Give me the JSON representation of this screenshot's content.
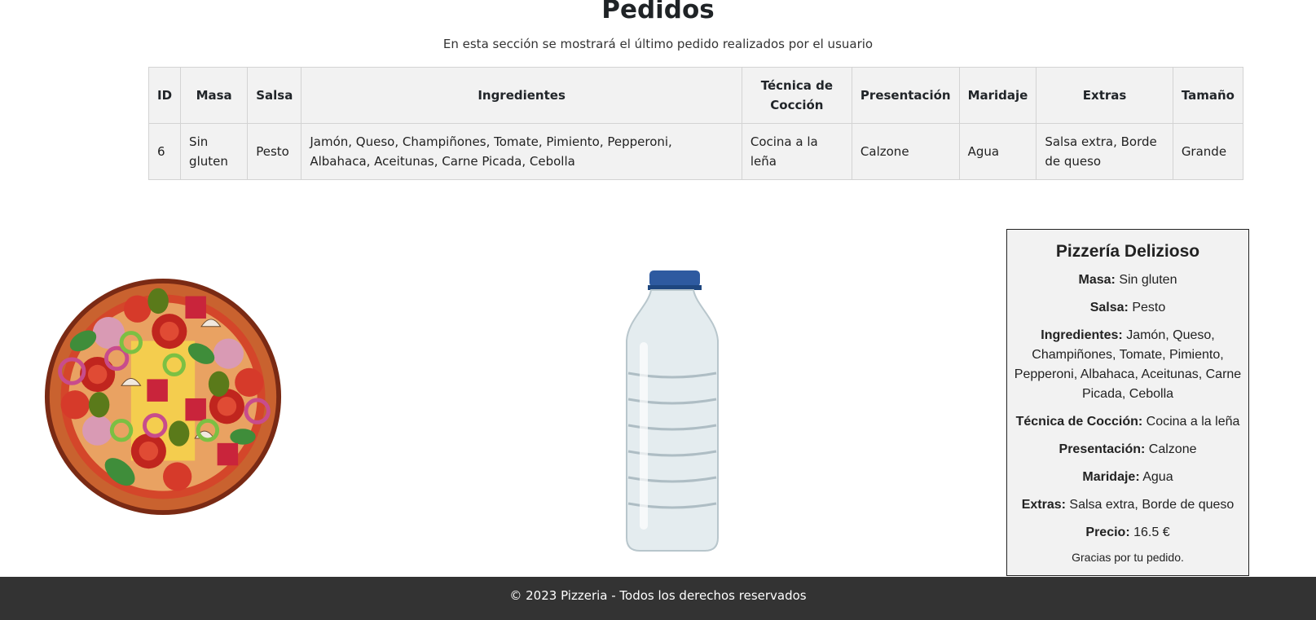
{
  "header": {
    "title": "Pedidos",
    "subtitle": "En esta sección se mostrará el último pedido realizados por el usuario"
  },
  "orders_table": {
    "columns": [
      "ID",
      "Masa",
      "Salsa",
      "Ingredientes",
      "Técnica de Cocción",
      "Presentación",
      "Maridaje",
      "Extras",
      "Tamaño"
    ],
    "rows": [
      [
        "6",
        "Sin gluten",
        "Pesto",
        "Jamón, Queso, Champiñones, Tomate, Pimiento, Pepperoni, Albahaca, Aceitunas, Carne Picada, Cebolla",
        "Cocina a la leña",
        "Calzone",
        "Agua",
        "Salsa extra, Borde de queso",
        "Grande"
      ]
    ]
  },
  "images": {
    "pizza": "pizza-illustration",
    "drink": "water-bottle-photo"
  },
  "receipt": {
    "title": "Pizzería Delizioso",
    "lines": [
      {
        "label": "Masa:",
        "value": "Sin gluten"
      },
      {
        "label": "Salsa:",
        "value": "Pesto"
      },
      {
        "label": "Ingredientes:",
        "value": "Jamón, Queso, Champiñones, Tomate, Pimiento, Pepperoni, Albahaca, Aceitunas, Carne Picada, Cebolla"
      },
      {
        "label": "Técnica de Cocción:",
        "value": "Cocina a la leña"
      },
      {
        "label": "Presentación:",
        "value": "Calzone"
      },
      {
        "label": "Maridaje:",
        "value": "Agua"
      },
      {
        "label": "Extras:",
        "value": "Salsa extra, Borde de queso"
      },
      {
        "label": "Precio:",
        "value": "16.5 €"
      }
    ],
    "thanks": "Gracias por tu pedido."
  },
  "footer": {
    "text": "© 2023 Pizzeria - Todos los derechos reservados"
  },
  "colors": {
    "footer_bg": "#333333",
    "table_bg": "#f2f2f2",
    "card_bg": "#f2f2f2"
  }
}
